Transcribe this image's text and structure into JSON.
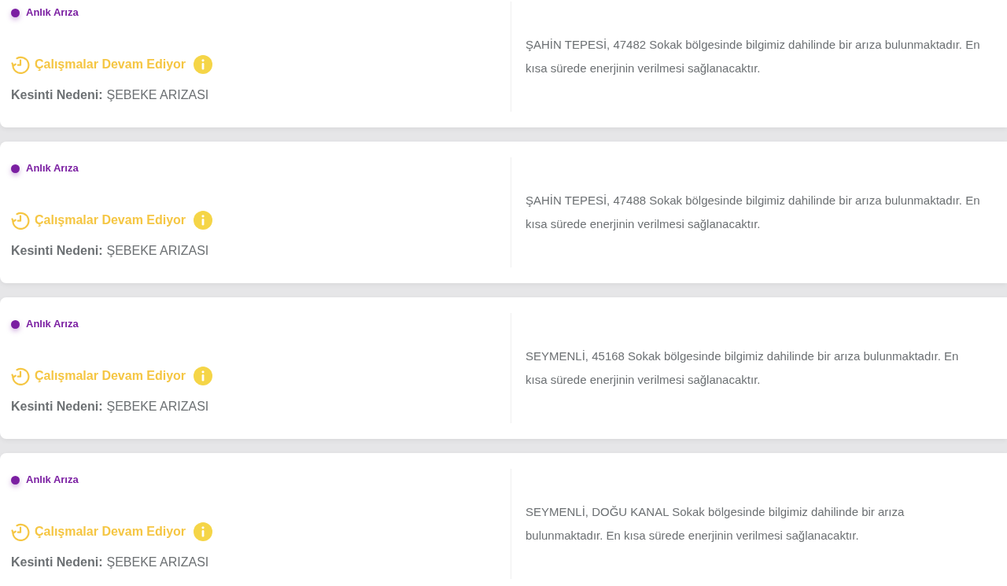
{
  "outages": [
    {
      "type_label": "Anlık Arıza",
      "status": "Çalışmalar Devam Ediyor",
      "reason_label": "Kesinti Nedeni:",
      "reason": "ŞEBEKE ARIZASI",
      "description": "ŞAHİN TEPESİ, 47482 Sokak bölgesinde bilgimiz dahilinde bir arıza bulunmaktadır. En kısa sürede enerjinin verilmesi sağlanacaktır."
    },
    {
      "type_label": "Anlık Arıza",
      "status": "Çalışmalar Devam Ediyor",
      "reason_label": "Kesinti Nedeni:",
      "reason": "ŞEBEKE ARIZASI",
      "description": "ŞAHİN TEPESİ, 47488 Sokak bölgesinde bilgimiz dahilinde bir arıza bulunmaktadır. En kısa sürede enerjinin verilmesi sağlanacaktır."
    },
    {
      "type_label": "Anlık Arıza",
      "status": "Çalışmalar Devam Ediyor",
      "reason_label": "Kesinti Nedeni:",
      "reason": "ŞEBEKE ARIZASI",
      "description": "SEYMENLİ, 45168 Sokak bölgesinde bilgimiz dahilinde bir arıza bulunmaktadır. En kısa sürede enerjinin verilmesi sağlanacaktır."
    },
    {
      "type_label": "Anlık Arıza",
      "status": "Çalışmalar Devam Ediyor",
      "reason_label": "Kesinti Nedeni:",
      "reason": "ŞEBEKE ARIZASI",
      "description": "SEYMENLİ, DOĞU KANAL Sokak bölgesinde bilgimiz dahilinde bir arıza bulunmaktadır. En kısa sürede enerjinin verilmesi sağlanacaktır."
    }
  ]
}
